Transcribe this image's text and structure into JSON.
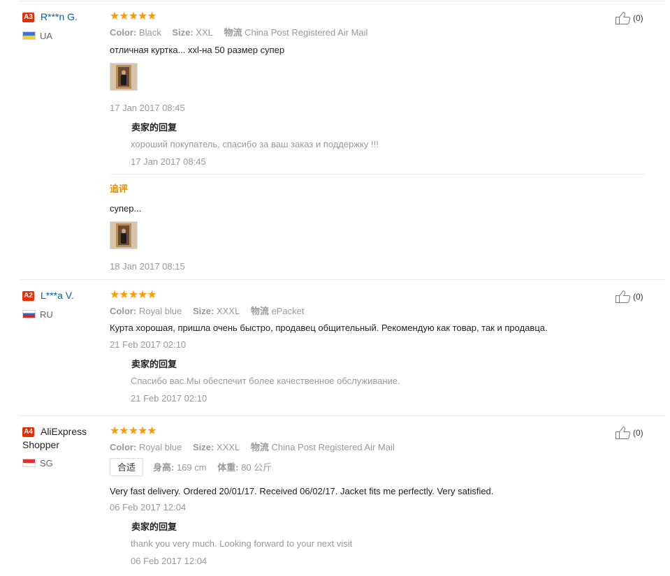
{
  "reviews": [
    {
      "badge": "A3",
      "name": "R***n G.",
      "country": "UA",
      "rating": 5,
      "stars": "★★★★★",
      "color_label": "Color:",
      "color_value": "Black",
      "size_label": "Size:",
      "size_value": "XXL",
      "shipping_label": "物流",
      "shipping_value": "China Post Registered Air Mail",
      "text": "отличная куртка... xxl-на 50 размер супер",
      "date": "17 Jan 2017 08:45",
      "reply_title": "卖家的回复",
      "reply_text": "хороший покупатель, спасибо за ваш заказ и поддержку !!!",
      "reply_date": "17 Jan 2017 08:45",
      "additional_label": "追评",
      "additional_text": "супер...",
      "additional_date": "18 Jan 2017 08:15",
      "likes": "(0)"
    },
    {
      "badge": "A2",
      "name": "L***a V.",
      "country": "RU",
      "rating": 5,
      "stars": "★★★★★",
      "color_label": "Color:",
      "color_value": "Royal blue",
      "size_label": "Size:",
      "size_value": "XXXL",
      "shipping_label": "物流",
      "shipping_value": "ePacket",
      "text": "Курта хорошая, пришла очень быстро, продавец общительный. Рекомендую как товар, так и продавца.",
      "date": "21 Feb 2017 02:10",
      "reply_title": "卖家的回复",
      "reply_text": "Спасибо вас.Мы обеспечит более качественное обслуживание.",
      "reply_date": "21 Feb 2017 02:10",
      "likes": "(0)"
    },
    {
      "badge": "A4",
      "name": "AliExpress Shopper",
      "country": "SG",
      "rating": 5,
      "stars": "★★★★★",
      "color_label": "Color:",
      "color_value": "Royal blue",
      "size_label": "Size:",
      "size_value": "XXXL",
      "shipping_label": "物流",
      "shipping_value": "China Post Registered Air Mail",
      "fit_tag": "合适",
      "height_label": "身高:",
      "height_value": "169 cm",
      "weight_label": "体重:",
      "weight_value": "80 公斤",
      "text": "Very fast delivery. Ordered 20/01/17. Received 06/02/17. Jacket fits me perfectly. Very satisfied.",
      "date": "06 Feb 2017 12:04",
      "reply_title": "卖家的回复",
      "reply_text": "thank you very much. Looking forward to your next visit",
      "reply_date": "06 Feb 2017 12:04",
      "likes": "(0)"
    }
  ],
  "icons": {
    "like": "thumbs-up-icon",
    "flag_ua": "ukraine-flag-icon",
    "flag_ru": "russia-flag-icon",
    "flag_sg": "singapore-flag-icon",
    "photo": "review-photo-thumbnail"
  },
  "colors": {
    "accent_star": "#ff9a00",
    "badge_red": "#e62e04",
    "user_link": "#0b5cad",
    "additional_orange": "#e88a00",
    "muted_text": "#999999"
  }
}
